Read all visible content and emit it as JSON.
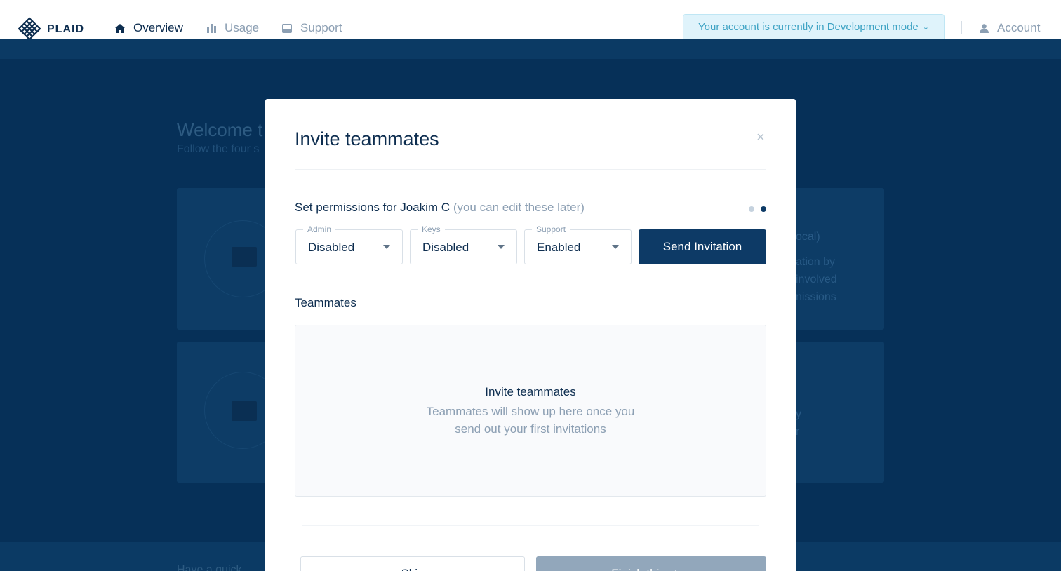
{
  "nav": {
    "logo_text": "PLAID",
    "items": [
      {
        "label": "Overview",
        "icon": "home-icon",
        "active": true
      },
      {
        "label": "Usage",
        "icon": "bar-chart-icon",
        "active": false
      },
      {
        "label": "Support",
        "icon": "inbox-icon",
        "active": false
      }
    ],
    "dev_banner": "Your account is currently in Development mode",
    "account_label": "Account"
  },
  "background": {
    "title": "Welcome t",
    "subtitle": "Follow the four s",
    "card1_text": [
      "ocal)",
      "ation by",
      "involved",
      "nissions"
    ],
    "card2_text": [
      "y",
      "r"
    ],
    "footer_text": "Have a quick"
  },
  "modal": {
    "title": "Invite teammates",
    "close_symbol": "×",
    "permissions_label": "Set permissions for Joakim C",
    "permissions_hint": "(you can edit these later)",
    "selects": [
      {
        "legend": "Admin",
        "value": "Disabled"
      },
      {
        "legend": "Keys",
        "value": "Disabled"
      },
      {
        "legend": "Support",
        "value": "Enabled"
      }
    ],
    "send_button": "Send Invitation",
    "teammates_label": "Teammates",
    "empty_title": "Invite teammates",
    "empty_text_line1": "Teammates will show up here once you",
    "empty_text_line2": "send out your first invitations",
    "skip_button": "Skip",
    "finish_button": "Finish this step",
    "step_current": 2,
    "step_total": 2
  },
  "colors": {
    "brand_navy": "#0d3a66",
    "overlay_bg": "#063058",
    "banner_bg": "#dff3fb",
    "banner_text": "#3ea3c4",
    "muted_text": "#8c9fb3"
  }
}
